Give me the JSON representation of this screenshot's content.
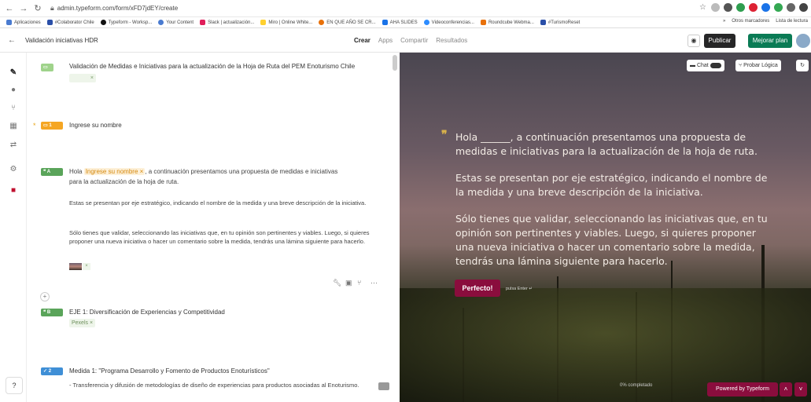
{
  "browser": {
    "url": "admin.typeform.com/form/xFD7jdEY/create",
    "bookmarks": [
      "Aplicaciones",
      "#Colaborator Chile",
      "Typeform - Worksp...",
      "Your Content",
      "Slack | actualización...",
      "Miro | Online White...",
      "EN QUE AÑO SE CR...",
      "AHA SLIDES",
      "Videoconferencias...",
      "Roundcube Webma...",
      "#TurismoReset"
    ],
    "bookmarks_right": [
      "»",
      "Otros marcadores",
      "Lista de lectura"
    ]
  },
  "header": {
    "back": "←",
    "form_title": "Validación iniciativas HDR",
    "tabs": [
      "Crear",
      "Apps",
      "Compartir",
      "Resultados"
    ],
    "publish": "Publicar",
    "upgrade": "Mejorar plan"
  },
  "questions": {
    "q0": {
      "title": "Validación de Medidas e Iniciativas para la actualización de la Hoja de Ruta del PEM Enoturismo Chile",
      "chip": "×"
    },
    "q1": {
      "badge": "1",
      "title": "Ingrese su nombre",
      "required": "*"
    },
    "qA": {
      "badge": "A",
      "pre": "Hola",
      "chip": "Ingrese su nombre ×",
      "post": ", a continuación presentamos una propuesta de medidas e iniciativas",
      "line2": "para la actualización de la hoja de ruta.",
      "p2": "Estas se presentan por eje estratégico, indicando el nombre de la medida y una breve descripción de la iniciativa.",
      "p3": "Sólo tienes que validar, seleccionando las iniciativas que, en tu opinión son pertinentes y viables. Luego, si quieres proponer una nueva iniciativa o hacer un comentario sobre la medida, tendrás una lámina siguiente para hacerlo."
    },
    "qB": {
      "badge": "B",
      "title": "EJE 1: Diversificación de Experiencias y Competitividad",
      "chip": "Pexels ×"
    },
    "q2": {
      "badge": "2",
      "title": "Medida 1: \"Programa Desarrollo y Fomento de Productos Enoturísticos\"",
      "desc": "- Transferencia y difusión de metodologías de diseño de experiencias para productos asociadas al Enoturismo."
    }
  },
  "preview": {
    "chat": "Chat",
    "logic": "Probar Lógica",
    "p1": "Hola ______, a continuación presentamos una propuesta de medidas e iniciativas para la actualización de la hoja de ruta.",
    "p2": "Estas se presentan por eje estratégico, indicando el nombre de la medida y una breve descripción de la iniciativa.",
    "p3": "Sólo tienes que validar, seleccionando las iniciativas que, en tu opinión son pertinentes y viables. Luego, si quieres proponer una nueva iniciativa o hacer un comentario sobre la medida, tendrás una lámina siguiente para hacerlo.",
    "ok": "Perfecto!",
    "enter": "pulsa Enter ↵",
    "progress": "0% completado",
    "powered": "Powered by Typeform"
  },
  "colors": {
    "accent": "#8a0d3d",
    "upgrade": "#0a7b55",
    "statement_badge": "#5aa45a",
    "text_badge": "#f5a623"
  }
}
